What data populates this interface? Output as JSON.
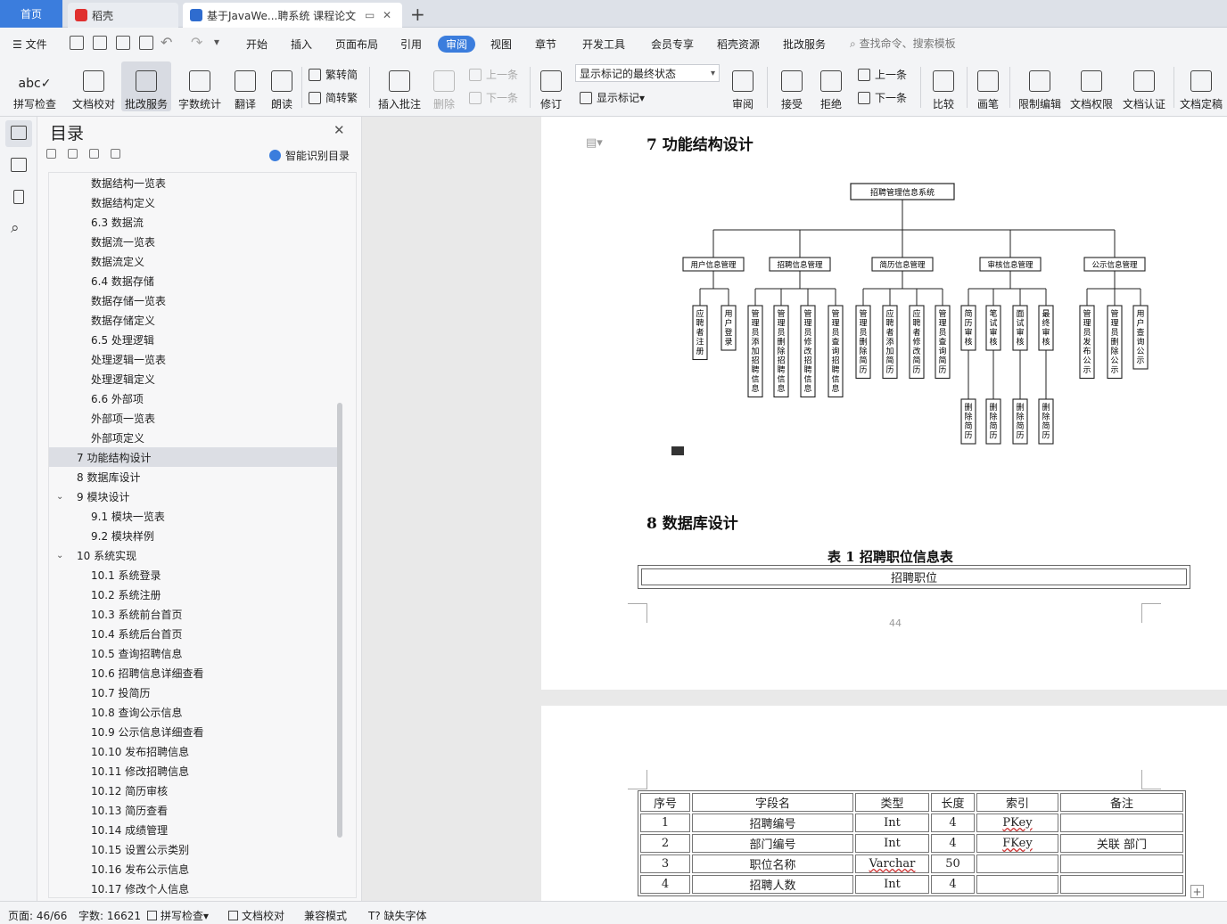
{
  "tabs": {
    "home": "首页",
    "daoke": "稻壳",
    "doc": "基于JavaWe...聘系统 课程论文"
  },
  "menu": {
    "file": "文件",
    "items": [
      "开始",
      "插入",
      "页面布局",
      "引用",
      "审阅",
      "视图",
      "章节",
      "开发工具",
      "会员专享",
      "稻壳资源",
      "批改服务"
    ],
    "active": "审阅",
    "search": "查找命令、搜索模板"
  },
  "ribbon": {
    "spell": "拼写检查",
    "proof": "文档校对",
    "correct": "批改服务",
    "count": "字数统计",
    "translate": "翻译",
    "read": "朗读",
    "trad": "繁转简",
    "simp": "简转繁",
    "insert_comment": "插入批注",
    "delete": "删除",
    "prev_comment": "上一条",
    "next_comment": "下一条",
    "revise": "修订",
    "mark_state": "显示标记的最终状态",
    "show_mark": "显示标记",
    "review": "审阅",
    "accept": "接受",
    "reject": "拒绝",
    "prev_change": "上一条",
    "next_change": "下一条",
    "compare": "比较",
    "pen": "画笔",
    "restrict": "限制编辑",
    "permission": "文档权限",
    "certify": "文档认证",
    "finalize": "文档定稿"
  },
  "toc": {
    "title": "目录",
    "smart": "智能识别目录",
    "items": [
      {
        "text": "数据结构一览表"
      },
      {
        "text": "数据结构定义"
      },
      {
        "text": "6.3  数据流"
      },
      {
        "text": "数据流一览表"
      },
      {
        "text": "数据流定义"
      },
      {
        "text": "6.4  数据存储"
      },
      {
        "text": "数据存储一览表"
      },
      {
        "text": "数据存储定义"
      },
      {
        "text": "6.5  处理逻辑"
      },
      {
        "text": "处理逻辑一览表"
      },
      {
        "text": "处理逻辑定义"
      },
      {
        "text": "6.6  外部项"
      },
      {
        "text": "外部项一览表"
      },
      {
        "text": "外部项定义"
      },
      {
        "text": "7   功能结构设计"
      },
      {
        "text": "8   数据库设计"
      },
      {
        "text": "9   模块设计"
      },
      {
        "text": "9.1  模块一览表"
      },
      {
        "text": "9.2  模块样例"
      },
      {
        "text": "10   系统实现"
      },
      {
        "text": "10.1  系统登录"
      },
      {
        "text": "10.2  系统注册"
      },
      {
        "text": "10.3  系统前台首页"
      },
      {
        "text": "10.4 系统后台首页"
      },
      {
        "text": "10.5  查询招聘信息"
      },
      {
        "text": "10.6  招聘信息详细查看"
      },
      {
        "text": "10.7  投简历"
      },
      {
        "text": "10.8  查询公示信息"
      },
      {
        "text": "10.9  公示信息详细查看"
      },
      {
        "text": "10.10 发布招聘信息"
      },
      {
        "text": "10.11  修改招聘信息"
      },
      {
        "text": "10.12 简历审核"
      },
      {
        "text": "10.13    简历查看"
      },
      {
        "text": "10.14  成绩管理"
      },
      {
        "text": "10.15  设置公示类别"
      },
      {
        "text": "10.16 发布公示信息"
      },
      {
        "text": "10.17  修改个人信息"
      }
    ]
  },
  "document": {
    "heading7": "7    功能结构设计",
    "heading8": "8    数据库设计",
    "diagram": {
      "root": "招聘管理信息系统",
      "groups": [
        {
          "name": "用户信息管理",
          "leaves": [
            "应聘者注册",
            "用户登录"
          ]
        },
        {
          "name": "招聘信息管理",
          "leaves": [
            "管理员添加招聘信息",
            "管理员删除招聘信息",
            "管理员修改招聘信息",
            "管理员查询招聘信息"
          ]
        },
        {
          "name": "简历信息管理",
          "leaves": [
            "管理员删除简历",
            "应聘者添加简历",
            "应聘者修改简历",
            "管理员查询简历"
          ]
        },
        {
          "name": "审核信息管理",
          "leaves": [
            "简历审核",
            "笔试审核",
            "面试审核",
            "最终审核"
          ],
          "subleaves": [
            "删除简历",
            "删除简历",
            "删除简历",
            "删除简历"
          ]
        },
        {
          "name": "公示信息管理",
          "leaves": [
            "管理员发布公示",
            "管理员删除公示",
            "用户查询公示"
          ]
        }
      ]
    },
    "table_caption": "表 1  招聘职位信息表",
    "table1_header": "招聘职位",
    "page_number": "44",
    "table2": {
      "headers": [
        "序号",
        "字段名",
        "类型",
        "长度",
        "索引",
        "备注"
      ],
      "rows": [
        [
          "1",
          "招聘编号",
          "Int",
          "4",
          "PKey",
          ""
        ],
        [
          "2",
          "部门编号",
          "Int",
          "4",
          "FKey",
          "关联  部门"
        ],
        [
          "3",
          "职位名称",
          "Varchar",
          "50",
          "",
          ""
        ],
        [
          "4",
          "招聘人数",
          "Int",
          "4",
          "",
          ""
        ]
      ]
    }
  },
  "status": {
    "page": "页面: 46/66",
    "words": "字数: 16621",
    "spell": "拼写检查",
    "proof": "文档校对",
    "compat": "兼容模式",
    "missing_font": "缺失字体"
  },
  "colors": {
    "accent": "#3b7ddd"
  }
}
